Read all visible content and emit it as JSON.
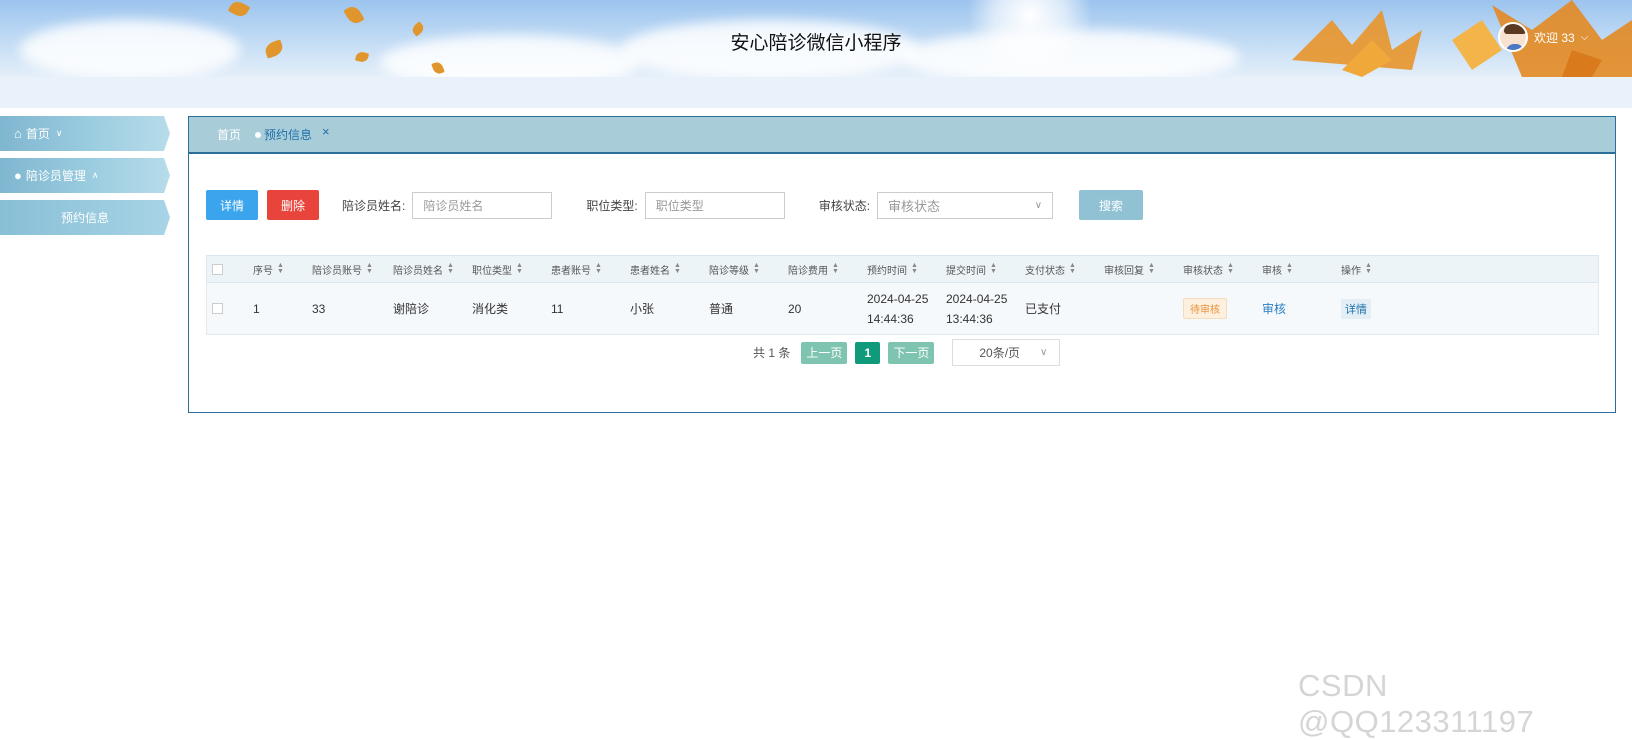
{
  "header": {
    "title": "安心陪诊微信小程序",
    "welcome": "欢迎 33"
  },
  "sidebar": {
    "items": [
      {
        "label": "首页"
      },
      {
        "label": "陪诊员管理"
      },
      {
        "label": "预约信息"
      }
    ]
  },
  "tabs": {
    "home": "首页",
    "active": "预约信息",
    "close": "×"
  },
  "toolbar": {
    "detail": "详情",
    "delete": "删除",
    "name_label": "陪诊员姓名:",
    "name_placeholder": "陪诊员姓名",
    "position_label": "职位类型:",
    "position_placeholder": "职位类型",
    "status_label": "审核状态:",
    "status_placeholder": "审核状态",
    "search": "搜索"
  },
  "table": {
    "headers": [
      "序号",
      "陪诊员账号",
      "陪诊员姓名",
      "职位类型",
      "患者账号",
      "患者姓名",
      "陪诊等级",
      "陪诊费用",
      "预约时间",
      "提交时间",
      "支付状态",
      "审核回复",
      "审核状态",
      "审核",
      "操作"
    ],
    "rows": [
      {
        "index": "1",
        "escort_account": "33",
        "escort_name": "谢陪诊",
        "position": "消化类",
        "patient_account": "11",
        "patient_name": "小张",
        "level": "普通",
        "fee": "20",
        "appt_date": "2024-04-25",
        "appt_time": "14:44:36",
        "submit_date": "2024-04-25",
        "submit_time": "13:44:36",
        "pay_status": "已支付",
        "reply": "",
        "audit_status": "待审核",
        "audit": "审核",
        "action": "详情"
      }
    ]
  },
  "pager": {
    "total": "共 1 条",
    "prev": "上一页",
    "current": "1",
    "next": "下一页",
    "size": "20条/页"
  },
  "watermark": "CSDN @QQ123311197"
}
